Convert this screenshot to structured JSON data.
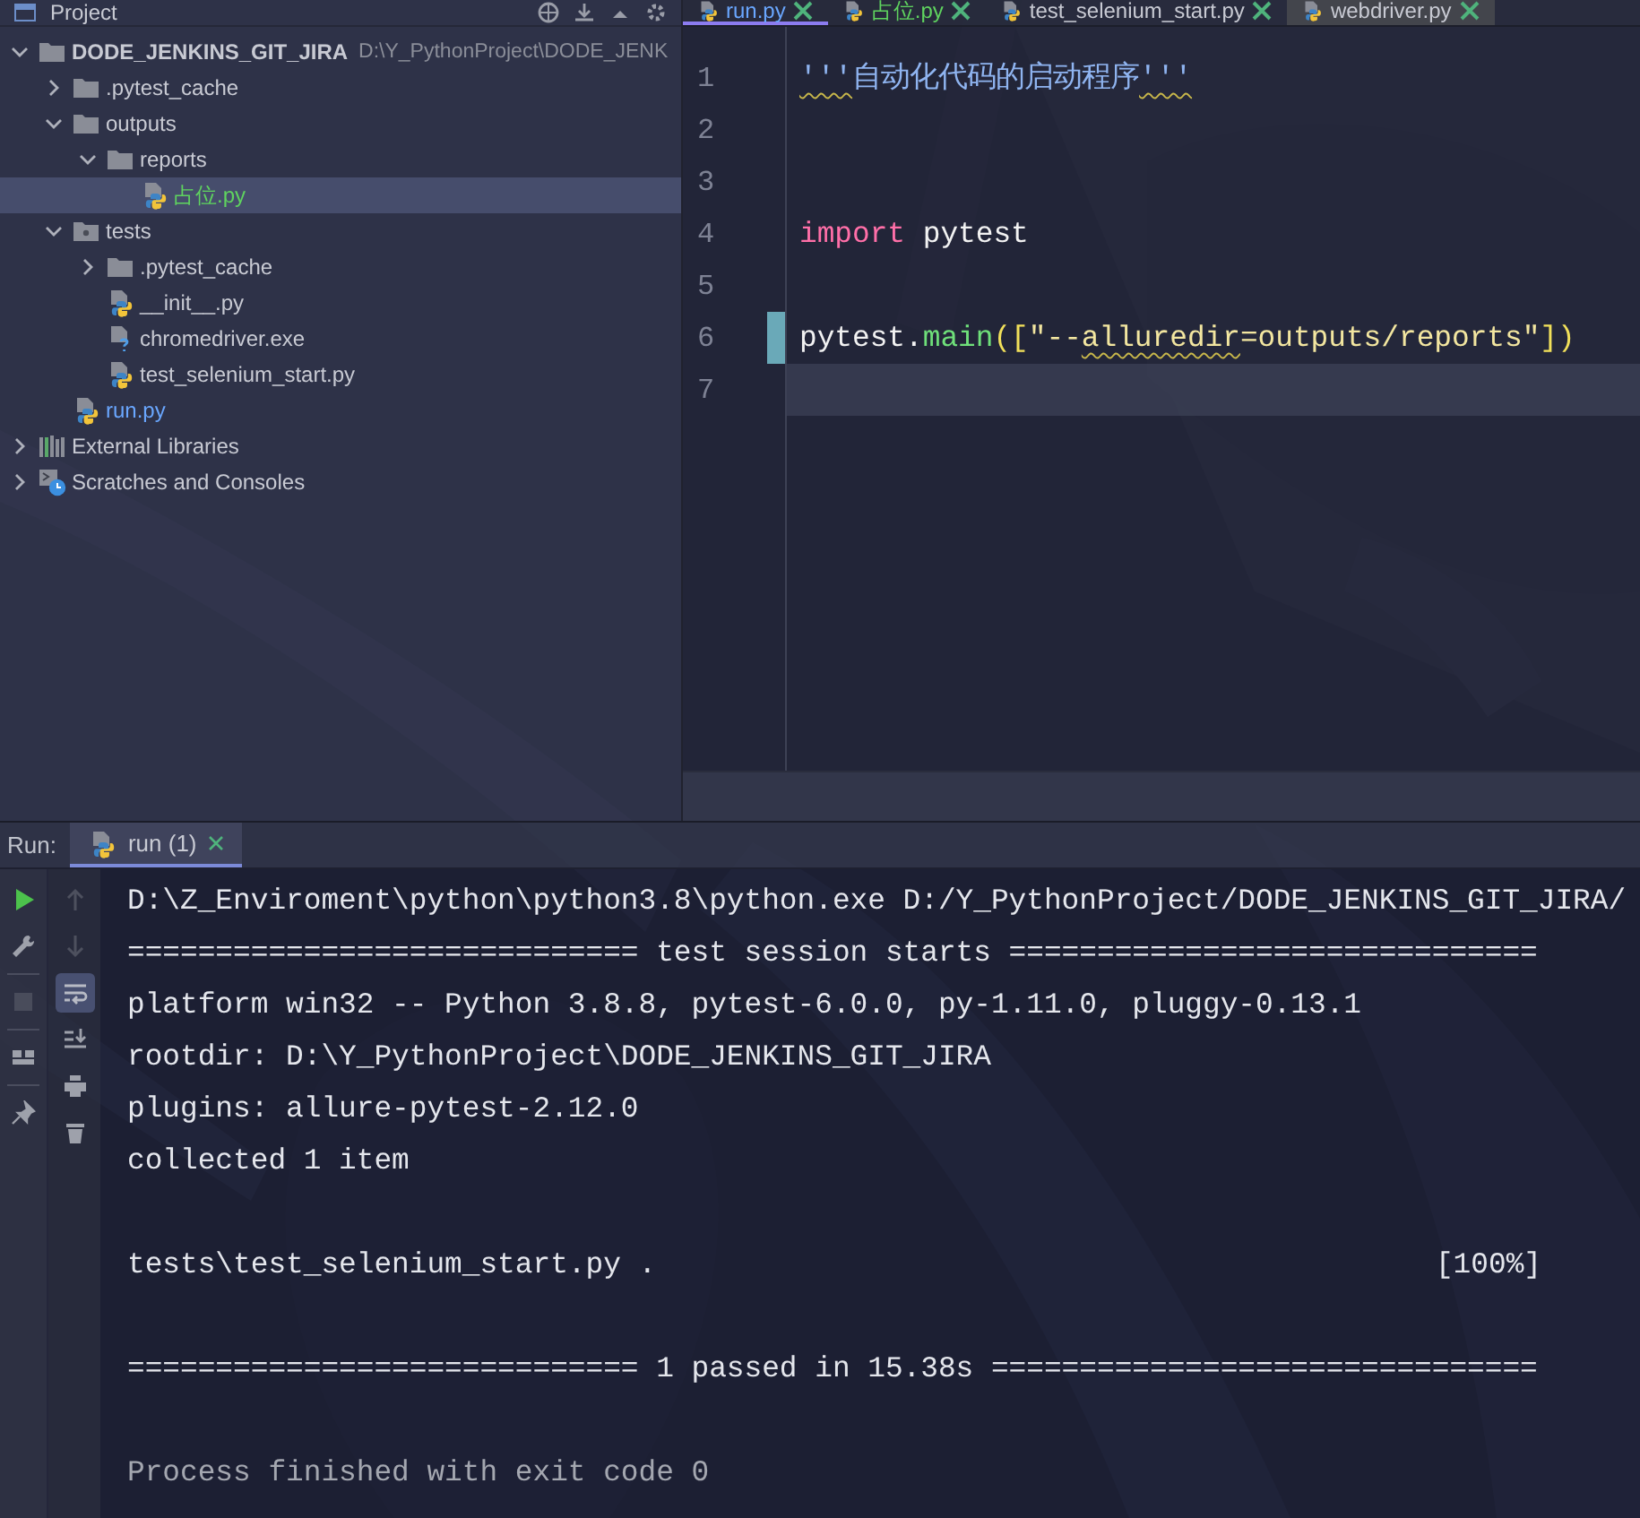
{
  "project_panel": {
    "title": "Project",
    "tree": [
      {
        "name": "DODE_JENKINS_GIT_JIRA",
        "path": "D:\\Y_PythonProject\\DODE_JENK",
        "kind": "root",
        "color": "#c8cad3",
        "expanded": true,
        "selected": false,
        "children": [
          {
            "name": ".pytest_cache",
            "kind": "folder",
            "color": "#c8cad3",
            "expanded": false,
            "selected": false
          },
          {
            "name": "outputs",
            "kind": "folder",
            "color": "#c8cad3",
            "expanded": true,
            "selected": false,
            "children": [
              {
                "name": "reports",
                "kind": "folder",
                "color": "#c8cad3",
                "expanded": true,
                "selected": false,
                "children": [
                  {
                    "name": "占位.py",
                    "kind": "python",
                    "color": "#5fd35f",
                    "selected": true
                  }
                ]
              }
            ]
          },
          {
            "name": "tests",
            "kind": "test_folder",
            "color": "#c8cad3",
            "expanded": true,
            "selected": false,
            "children": [
              {
                "name": ".pytest_cache",
                "kind": "folder",
                "color": "#c8cad3",
                "expanded": false,
                "selected": false
              },
              {
                "name": "__init__.py",
                "kind": "python",
                "color": "#c8cad3",
                "selected": false
              },
              {
                "name": "chromedriver.exe",
                "kind": "unknown",
                "color": "#c8cad3",
                "selected": false
              },
              {
                "name": "test_selenium_start.py",
                "kind": "python",
                "color": "#c8cad3",
                "selected": false
              }
            ]
          },
          {
            "name": "run.py",
            "kind": "python",
            "color": "#6aa7ff",
            "selected": false
          }
        ]
      },
      {
        "name": "External Libraries",
        "kind": "libraries",
        "color": "#c8cad3",
        "expanded": false,
        "selected": false
      },
      {
        "name": "Scratches and Consoles",
        "kind": "scratches",
        "color": "#c8cad3",
        "expanded": false,
        "selected": false
      }
    ]
  },
  "editor": {
    "tabs": [
      {
        "label": "run.py",
        "color": "#6aa7ff",
        "external": false,
        "selected": true
      },
      {
        "label": "占位.py",
        "color": "#5fd35f",
        "external": false,
        "selected": false
      },
      {
        "label": "test_selenium_start.py",
        "color": "#c8cad3",
        "external": false,
        "selected": false
      },
      {
        "label": "webdriver.py",
        "color": "#c8cad3",
        "external": true,
        "selected": false
      }
    ],
    "lines": [
      {
        "number": "1",
        "changed": false,
        "current": false,
        "tokens": [
          {
            "text": "'''",
            "kind": "docstring",
            "warn": true
          },
          {
            "text": "自动化代码的启动程序",
            "kind": "docstring",
            "warn": false
          },
          {
            "text": "'''",
            "kind": "docstring",
            "warn": true
          }
        ]
      },
      {
        "number": "2",
        "changed": false,
        "current": false
      },
      {
        "number": "3",
        "changed": false,
        "current": false
      },
      {
        "number": "4",
        "changed": false,
        "current": false,
        "tokens": [
          {
            "text": "import",
            "kind": "keyword",
            "warn": false
          },
          {
            "text": " pytest",
            "kind": "plain",
            "warn": false
          }
        ]
      },
      {
        "number": "5",
        "changed": false,
        "current": false
      },
      {
        "number": "6",
        "changed": true,
        "current": false,
        "tokens": [
          {
            "text": "pytest.",
            "kind": "plain",
            "warn": false
          },
          {
            "text": "main",
            "kind": "function",
            "warn": false
          },
          {
            "text": "([",
            "kind": "bracket",
            "warn": false
          },
          {
            "text": "\"--",
            "kind": "string",
            "warn": false
          },
          {
            "text": "alluredir",
            "kind": "string",
            "warn": true
          },
          {
            "text": "=outputs/reports\"",
            "kind": "string",
            "warn": false
          },
          {
            "text": "])",
            "kind": "bracket",
            "warn": false
          }
        ]
      },
      {
        "number": "7",
        "changed": false,
        "current": true
      }
    ]
  },
  "run_panel": {
    "label": "Run:",
    "tab": {
      "label": "run (1)",
      "selected": true
    },
    "tools_primary": [
      {
        "kind": "rerun",
        "disabled": false
      },
      {
        "kind": "settings",
        "disabled": false
      },
      {
        "kind": "stop",
        "disabled": true
      },
      {
        "kind": "layout",
        "disabled": false
      },
      {
        "kind": "pin",
        "disabled": false
      }
    ],
    "tools_secondary": [
      {
        "kind": "up",
        "disabled": true,
        "selected": false
      },
      {
        "kind": "down",
        "disabled": true,
        "selected": false
      },
      {
        "kind": "wrap",
        "disabled": false,
        "selected": true
      },
      {
        "kind": "scroll_end",
        "disabled": false,
        "selected": false
      },
      {
        "kind": "print",
        "disabled": false,
        "selected": false
      },
      {
        "kind": "trash",
        "disabled": false,
        "selected": false
      }
    ],
    "console_blocks": [
      {
        "lines": [
          {
            "text": "D:\\Z_Enviroment\\python\\python3.8\\python.exe D:/Y_PythonProject/DODE_JENKINS_GIT_JIRA/",
            "kind": "output"
          },
          {
            "text": "============================= test session starts ==============================",
            "kind": "output"
          },
          {
            "text": "platform win32 -- Python 3.8.8, pytest-6.0.0, py-1.11.0, pluggy-0.13.1",
            "kind": "output"
          },
          {
            "text": "rootdir: D:\\Y_PythonProject\\DODE_JENKINS_GIT_JIRA",
            "kind": "output"
          },
          {
            "text": "plugins: allure-pytest-2.12.0",
            "kind": "output"
          },
          {
            "text": "collected 1 item",
            "kind": "output"
          }
        ]
      },
      {
        "lines": [
          {
            "text": "tests\\test_selenium_start.py .",
            "right": "[100%]",
            "kind": "output"
          }
        ]
      },
      {
        "lines": [
          {
            "text": "============================= 1 passed in 15.38s ===============================",
            "kind": "output"
          }
        ]
      },
      {
        "lines": [
          {
            "text": "Process finished with exit code 0",
            "kind": "exit"
          }
        ]
      }
    ]
  }
}
